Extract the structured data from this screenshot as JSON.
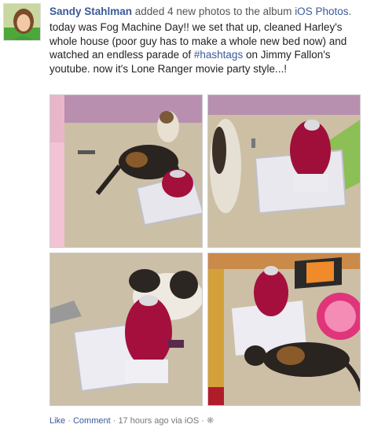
{
  "post": {
    "actor": "Sandy Stahlman",
    "action": " added 4 new photos to the album ",
    "album": "iOS Photos",
    "album_suffix": ".",
    "status_part1": "today was Fog Machine Day!! we set that up, cleaned Harley's whole house (poor guy has to make a whole new bed now) and watched an endless parade of ",
    "hashtag": "#hashtags",
    "status_part2": " on Jimmy Fallon's youtube. now it's Lone Ranger movie party style...!"
  },
  "footer": {
    "like": "Like",
    "sep1": " · ",
    "comment": "Comment",
    "sep2": " · ",
    "meta": "17 hours ago via iOS",
    "sep3": " · "
  },
  "icons": {
    "settings": "gear-icon"
  },
  "colors": {
    "link": "#3b5998",
    "meta_text": "#777777",
    "body_text": "#222222"
  }
}
